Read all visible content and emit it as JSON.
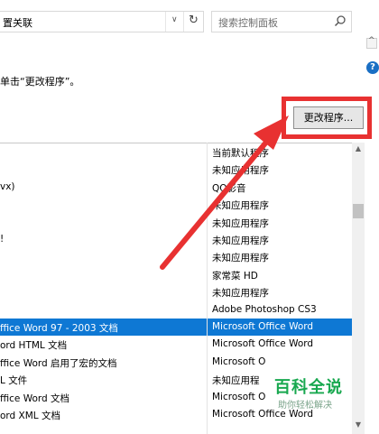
{
  "address_bar": {
    "path_text": "置关联"
  },
  "search": {
    "placeholder": "搜索控制面板"
  },
  "instruction": "单击“更改程序”。",
  "change_button_label": "更改程序...",
  "watermark": {
    "title": "百科全说",
    "subtitle": "助你轻松解决"
  },
  "colors": {
    "selection": "#0e78d4",
    "highlight": "#e83131",
    "watermark": "#18a84f"
  },
  "list": {
    "rows": [
      {
        "description": "",
        "current_default": "当前默认程序"
      },
      {
        "description": "",
        "current_default": "未知应用程序"
      },
      {
        "description": "vx)",
        "current_default": "QQ影音"
      },
      {
        "description": "",
        "current_default": "未知应用程序"
      },
      {
        "description": "",
        "current_default": "未知应用程序"
      },
      {
        "description": "!",
        "current_default": "未知应用程序"
      },
      {
        "description": "",
        "current_default": "未知应用程序"
      },
      {
        "description": "",
        "current_default": "家常菜 HD"
      },
      {
        "description": "",
        "current_default": "未知应用程序"
      },
      {
        "description": "",
        "current_default": "Adobe Photoshop CS3"
      },
      {
        "description": "ffice Word 97 - 2003 文档",
        "current_default": "Microsoft Office Word",
        "selected": true
      },
      {
        "description": "ord HTML 文档",
        "current_default": "Microsoft Office Word"
      },
      {
        "description": "ffice Word 启用了宏的文档",
        "current_default": "Microsoft O"
      },
      {
        "description": "L 文件",
        "current_default": "未知应用程"
      },
      {
        "description": "ffice Word 文档",
        "current_default": "Microsoft O"
      },
      {
        "description": "ord XML 文档",
        "current_default": "Microsoft Office Word"
      }
    ]
  }
}
